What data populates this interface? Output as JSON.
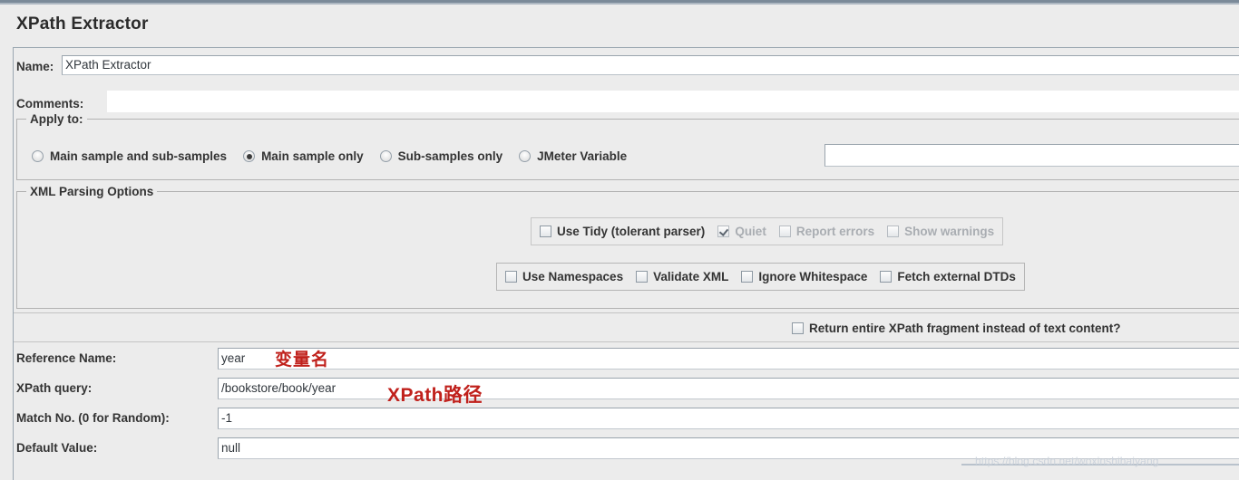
{
  "window": {
    "title": "XPath Extractor"
  },
  "fields": {
    "name_label": "Name:",
    "name_value": "XPath Extractor",
    "comments_label": "Comments:",
    "comments_value": ""
  },
  "apply_to": {
    "legend": "Apply to:",
    "options": [
      {
        "label": "Main sample and sub-samples",
        "selected": false
      },
      {
        "label": "Main sample only",
        "selected": true
      },
      {
        "label": "Sub-samples only",
        "selected": false
      },
      {
        "label": "JMeter Variable",
        "selected": false
      }
    ],
    "variable_value": ""
  },
  "xml_parsing": {
    "legend": "XML Parsing Options",
    "tidy_group": [
      {
        "label": "Use Tidy (tolerant parser)",
        "checked": false,
        "disabled": false
      },
      {
        "label": "Quiet",
        "checked": true,
        "disabled": true
      },
      {
        "label": "Report errors",
        "checked": false,
        "disabled": true
      },
      {
        "label": "Show warnings",
        "checked": false,
        "disabled": true
      }
    ],
    "options_group": [
      {
        "label": "Use Namespaces",
        "checked": false,
        "disabled": false
      },
      {
        "label": "Validate XML",
        "checked": false,
        "disabled": false
      },
      {
        "label": "Ignore Whitespace",
        "checked": false,
        "disabled": false
      },
      {
        "label": "Fetch external DTDs",
        "checked": false,
        "disabled": false
      }
    ],
    "fragment_option": {
      "label": "Return entire XPath fragment instead of text content?",
      "checked": false
    }
  },
  "extractor": {
    "reference_name_label": "Reference Name:",
    "reference_name_value": "year",
    "xpath_query_label": "XPath query:",
    "xpath_query_value": "/bookstore/book/year",
    "match_no_label": "Match No. (0 for Random):",
    "match_no_value": "-1",
    "default_value_label": "Default Value:",
    "default_value_value": "null"
  },
  "annotations": {
    "variable_name": "变量名",
    "xpath_path": "XPath路径"
  },
  "watermark": {
    "text": "https://blog.csdn.net/woxinshihaiyang"
  },
  "colors": {
    "panel_background": "#ececec",
    "annotation_red": "#c0211c",
    "label_text": "#333333",
    "disabled_text": "#a9adb2"
  }
}
